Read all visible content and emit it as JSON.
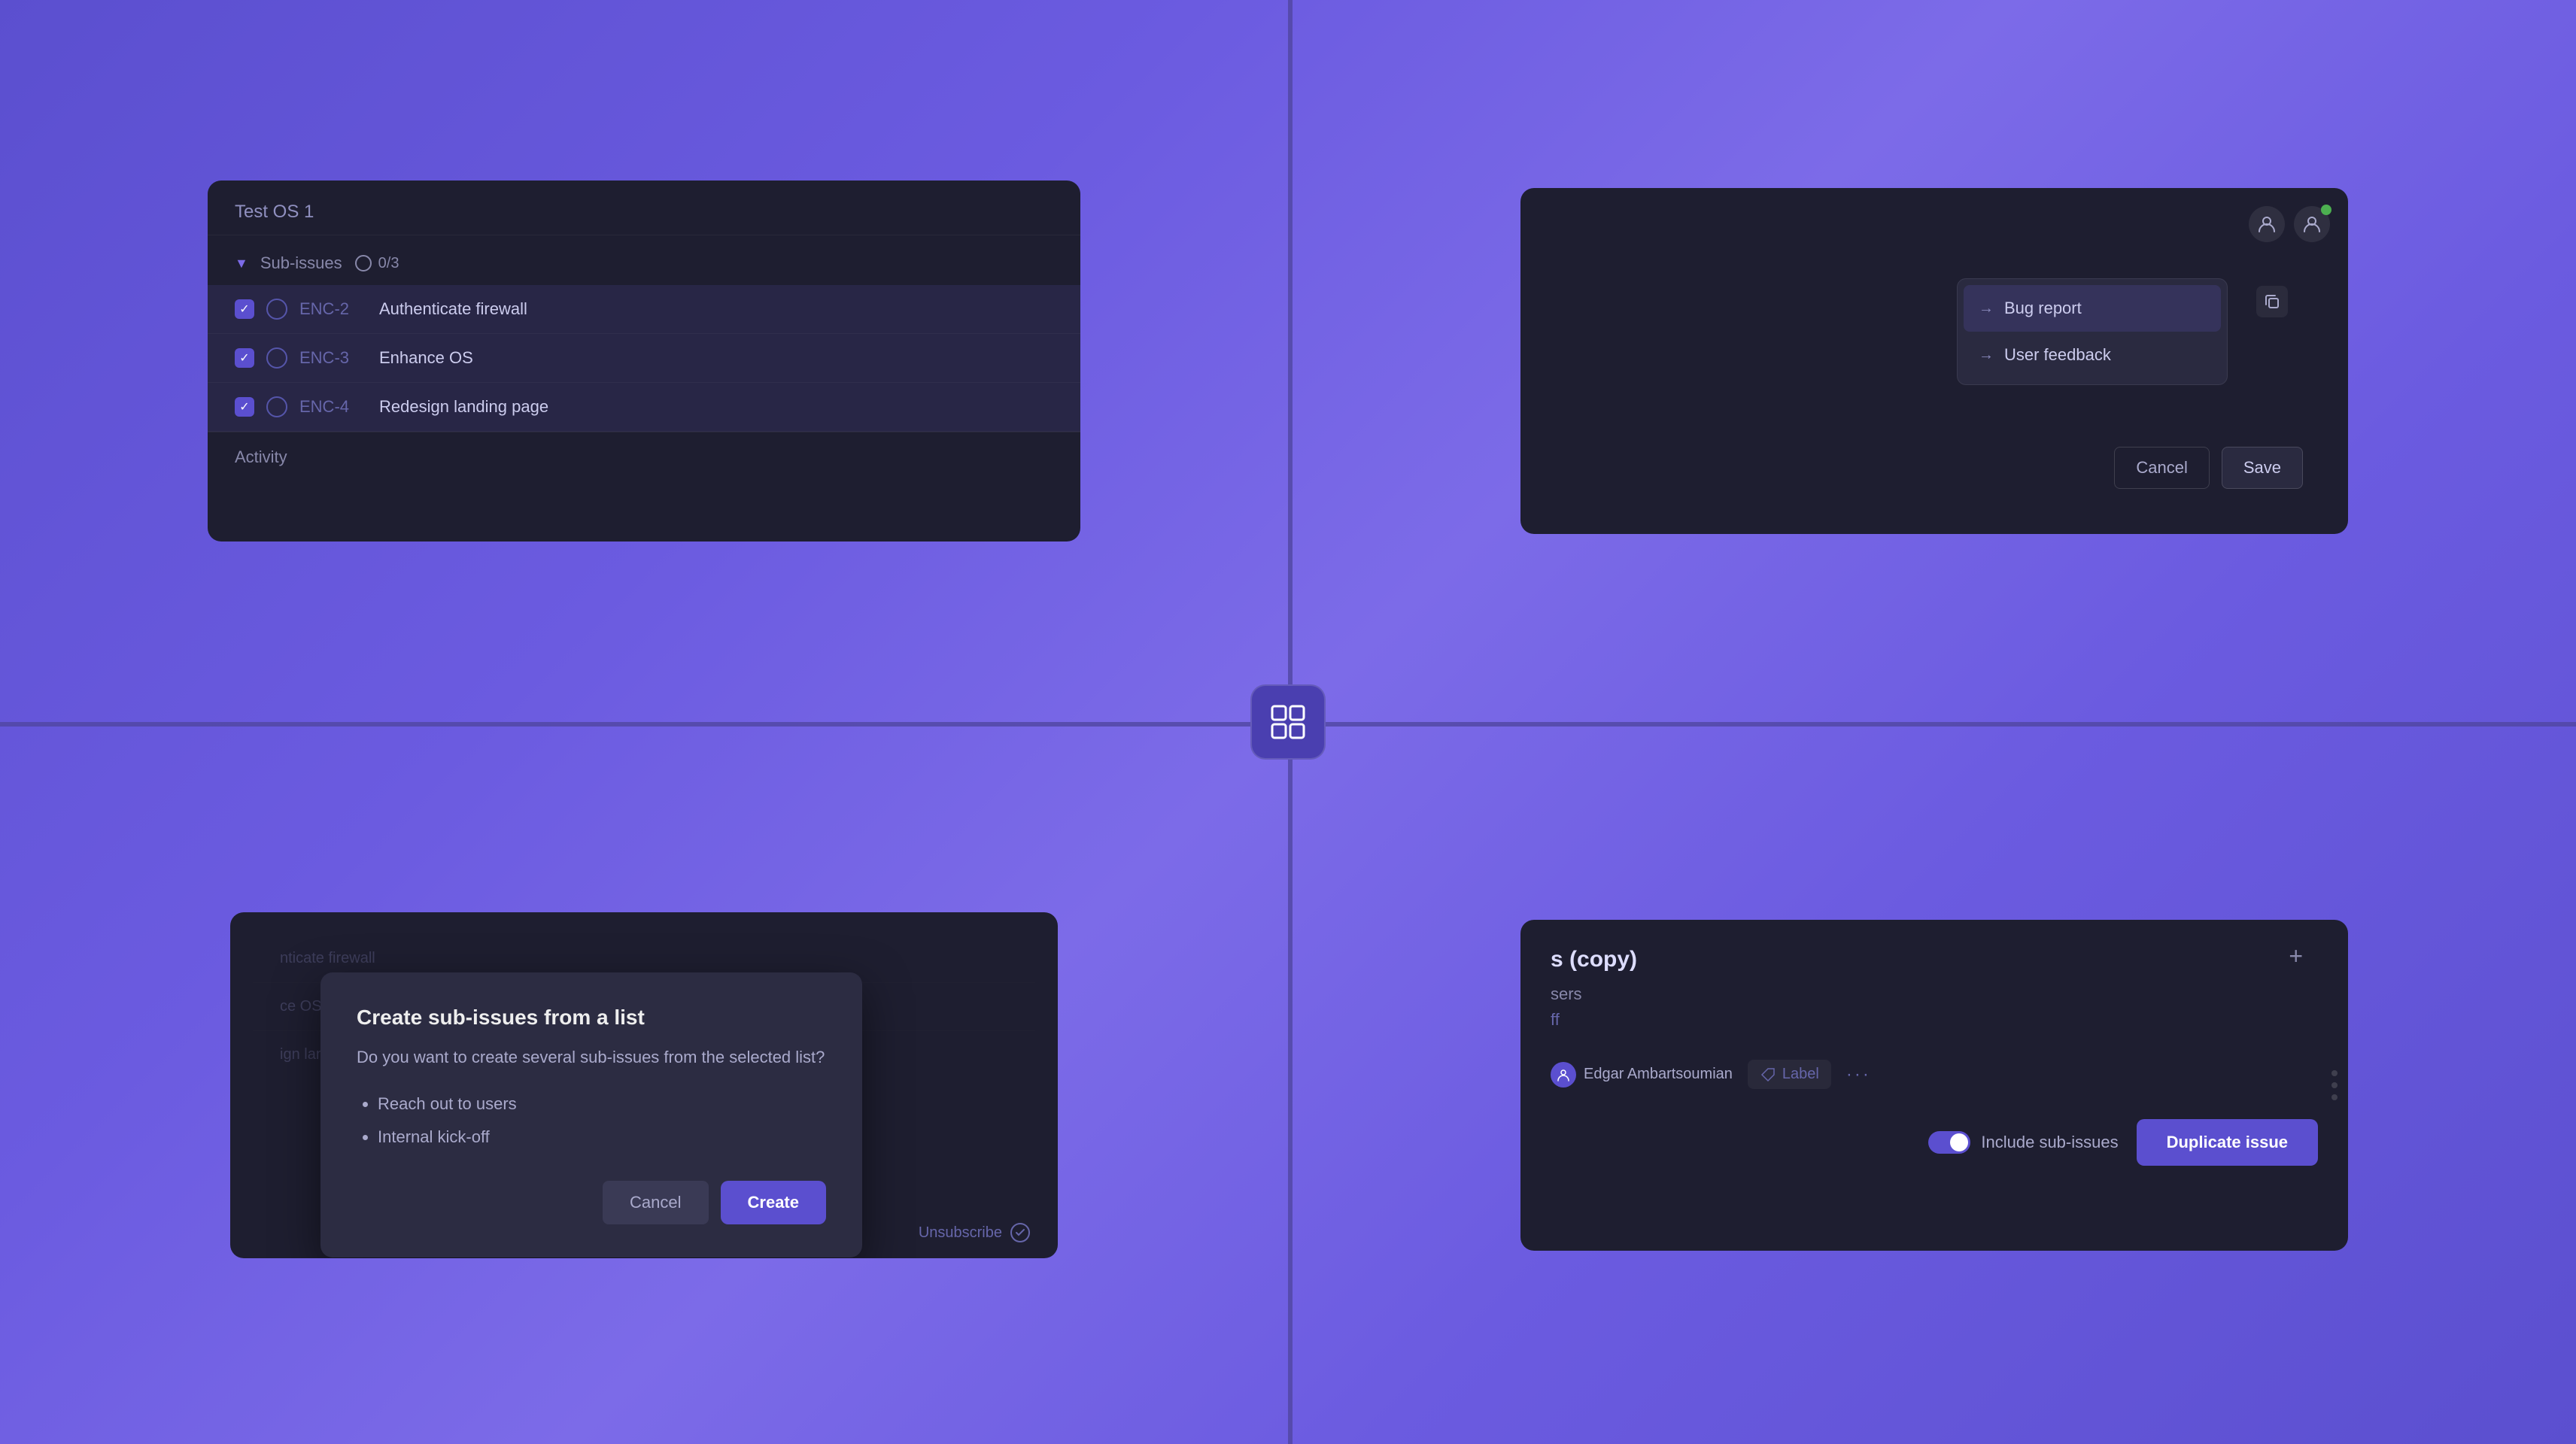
{
  "center": {
    "icon": "⊞"
  },
  "q1": {
    "header_text": "Test OS 1",
    "sub_issues_label": "Sub-issues",
    "progress": "0/3",
    "issues": [
      {
        "id": "ENC-2",
        "title": "Authenticate firewall"
      },
      {
        "id": "ENC-3",
        "title": "Enhance OS"
      },
      {
        "id": "ENC-4",
        "title": "Redesign landing page"
      }
    ],
    "activity_label": "Activity"
  },
  "q2": {
    "dropdown": {
      "items": [
        {
          "label": "Bug report",
          "active": true
        },
        {
          "label": "User feedback",
          "active": false
        }
      ]
    },
    "cancel_label": "Cancel",
    "save_label": "Save"
  },
  "q3": {
    "bg_issues": [
      "nticate firewall",
      "ce OS",
      "ign landing pag"
    ],
    "dialog": {
      "title": "Create sub-issues from a list",
      "body": "Do you want to create several sub-issues from the selected list?",
      "list_items": [
        "Reach out to users",
        "Internal kick-off"
      ],
      "cancel_label": "Cancel",
      "create_label": "Create"
    },
    "bottom_label": "Unsubscribe"
  },
  "q4": {
    "title": "s (copy)",
    "subtitle1": "sers",
    "subtitle2": "ff",
    "user_name": "Edgar Ambartsoumian",
    "label_text": "Label",
    "toggle_label": "Include sub-issues",
    "duplicate_label": "Duplicate issue"
  }
}
